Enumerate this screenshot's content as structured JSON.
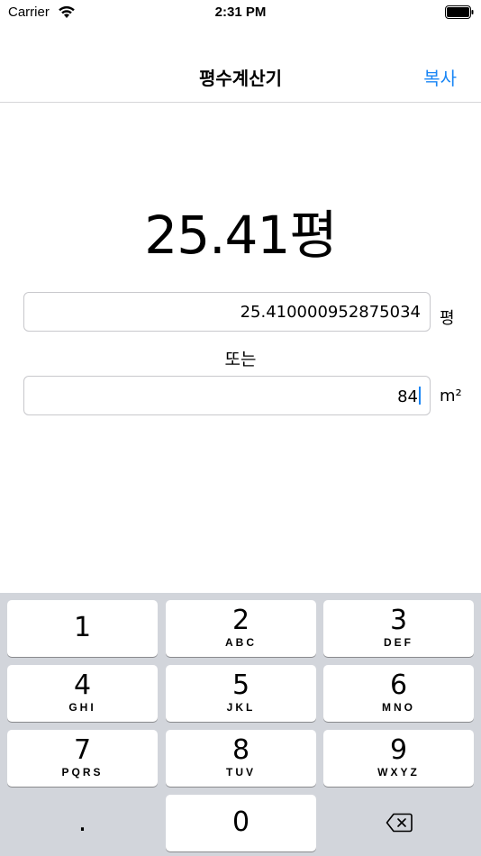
{
  "status_bar": {
    "carrier": "Carrier",
    "time": "2:31 PM"
  },
  "nav": {
    "title": "평수계산기",
    "action": "복사"
  },
  "result": "25.41평",
  "inputs": {
    "pyeong_value": "25.410000952875034",
    "pyeong_unit": "평",
    "or_label": "또는",
    "m2_value": "84",
    "m2_unit": "m²"
  },
  "keypad": {
    "keys": [
      {
        "digit": "1",
        "letters": ""
      },
      {
        "digit": "2",
        "letters": "ABC"
      },
      {
        "digit": "3",
        "letters": "DEF"
      },
      {
        "digit": "4",
        "letters": "GHI"
      },
      {
        "digit": "5",
        "letters": "JKL"
      },
      {
        "digit": "6",
        "letters": "MNO"
      },
      {
        "digit": "7",
        "letters": "PQRS"
      },
      {
        "digit": "8",
        "letters": "TUV"
      },
      {
        "digit": "9",
        "letters": "WXYZ"
      }
    ],
    "decimal": ".",
    "zero": "0"
  },
  "colors": {
    "accent": "#1a86f5",
    "keypad_background": "#d2d5db",
    "key_background": "#ffffff"
  },
  "icons": [
    "wifi-icon",
    "battery-icon",
    "delete-backspace-icon"
  ]
}
